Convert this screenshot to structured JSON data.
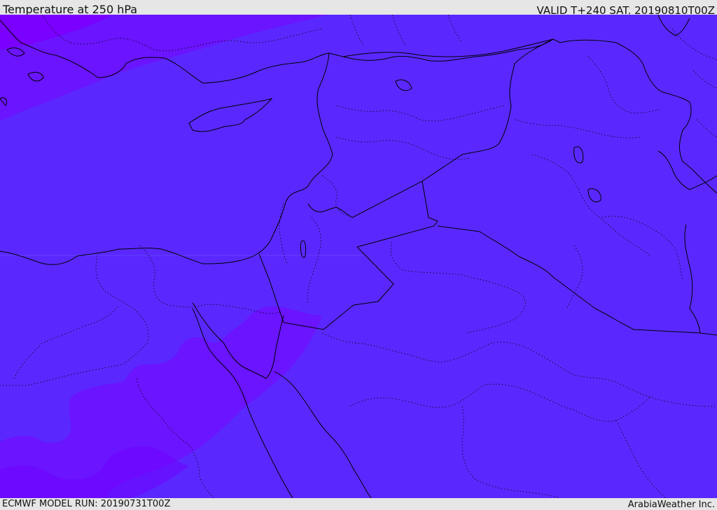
{
  "header": {
    "title": "Temperature at 250 hPa",
    "valid_time": "VALID T+240 SAT. 20190810T00Z"
  },
  "footer": {
    "model_run": "ECMWF MODEL RUN: 20190731T00Z",
    "credit": "ArabiaWeather Inc."
  },
  "map": {
    "field": "temperature-250hPa",
    "colors": {
      "base_fill": "#5a28ff",
      "cool_band": "#6a14ff",
      "cold_core": "#7a00ff",
      "coastline": "#000000",
      "border": "#000000"
    }
  }
}
